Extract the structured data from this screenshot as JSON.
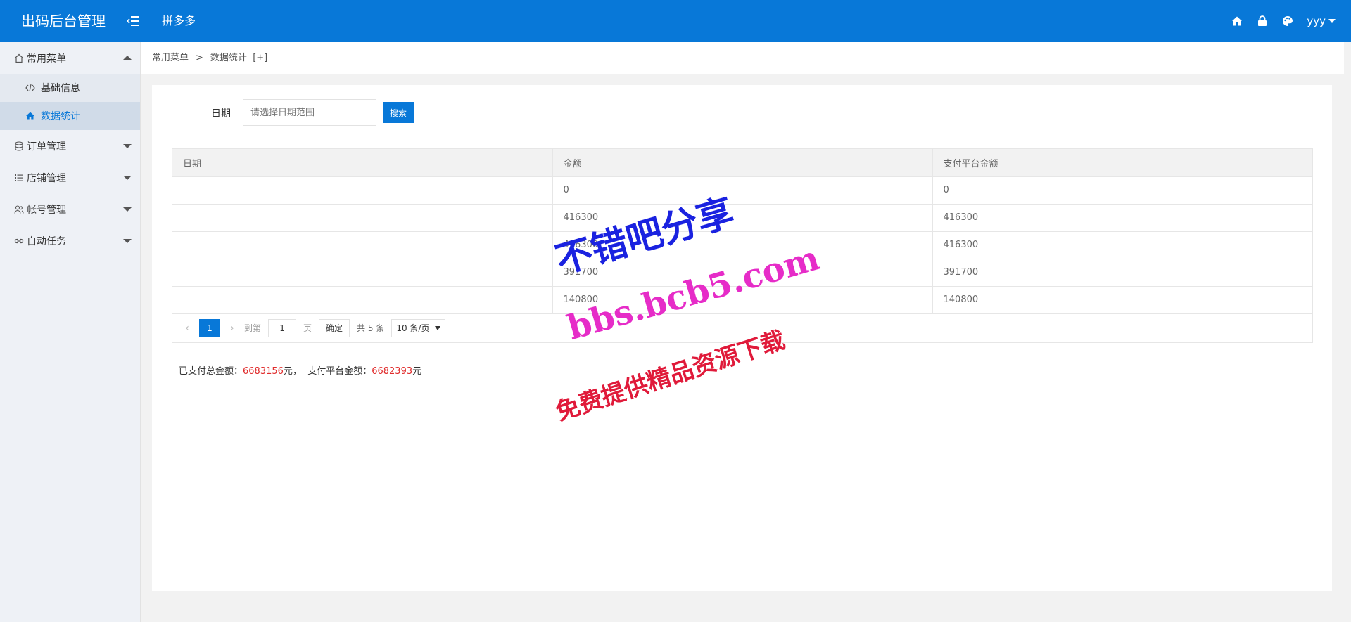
{
  "header": {
    "logo": "出码后台管理",
    "shop": "拼多多",
    "user": "yyy",
    "accent": "#0878d8"
  },
  "sidebar": {
    "groups": [
      {
        "label": "常用菜单",
        "icon": "home-outline-icon",
        "expanded": true,
        "items": [
          {
            "label": "基础信息",
            "icon": "code-icon"
          },
          {
            "label": "数据统计",
            "icon": "home-icon",
            "active": true
          }
        ]
      },
      {
        "label": "订单管理",
        "icon": "database-icon"
      },
      {
        "label": "店铺管理",
        "icon": "list-icon"
      },
      {
        "label": "帐号管理",
        "icon": "users-icon"
      },
      {
        "label": "自动任务",
        "icon": "link-icon"
      }
    ]
  },
  "breadcrumb": {
    "parent": "常用菜单",
    "separator": ">",
    "current": "数据统计",
    "extra": "[+]"
  },
  "search": {
    "label": "日期",
    "placeholder": "请选择日期范围",
    "button": "搜索"
  },
  "table": {
    "headers": [
      "日期",
      "金额",
      "支付平台金额"
    ],
    "rows": [
      [
        "",
        "0",
        "0"
      ],
      [
        "",
        "416300",
        "416300"
      ],
      [
        "",
        "416300",
        "416300"
      ],
      [
        "",
        "391700",
        "391700"
      ],
      [
        "",
        "140800",
        "140800"
      ]
    ]
  },
  "pager": {
    "current": "1",
    "goto_label": "到第",
    "goto_value": "1",
    "page_suffix": "页",
    "confirm": "确定",
    "total": "共 5 条",
    "size": "10 条/页"
  },
  "summary": {
    "paid_label": "已支付总金额：",
    "paid_value": "6683156",
    "unit1": "元，",
    "platform_label": "支付平台金额：",
    "platform_value": "6682393",
    "unit2": "元",
    "highlight": "#e02b2b"
  },
  "watermark": {
    "line1": "不错吧分享",
    "line2": "bbs.bcb5.com",
    "line3": "免费提供精品资源下载"
  }
}
